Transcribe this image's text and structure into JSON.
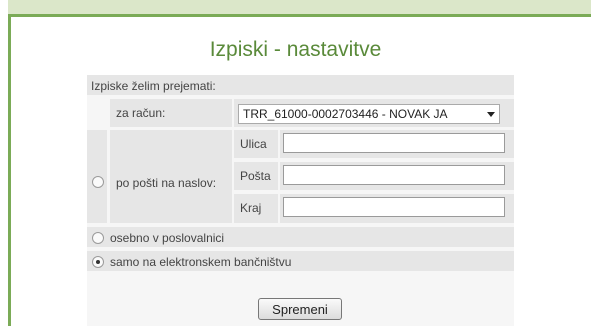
{
  "title": "Izpiski - nastavitve",
  "form": {
    "heading": "Izpiske želim prejemati:",
    "account_label": "za račun:",
    "account_value": "TRR_61000-0002703446 - NOVAK JA",
    "mail_option": "po pošti na naslov:",
    "street_label": "Ulica",
    "post_label": "Pošta",
    "city_label": "Kraj",
    "street_value": "",
    "post_value": "",
    "city_value": "",
    "branch_option": "osebno v poslovalnici",
    "ebank_option": "samo na elektronskem bančništvu",
    "selected_option": "samo na elektronskem bančništvu"
  },
  "submit_label": "Spremeni",
  "colors": {
    "accent": "#7bab57",
    "title": "#5a8a3a",
    "row_bg": "#e6e6e6"
  }
}
